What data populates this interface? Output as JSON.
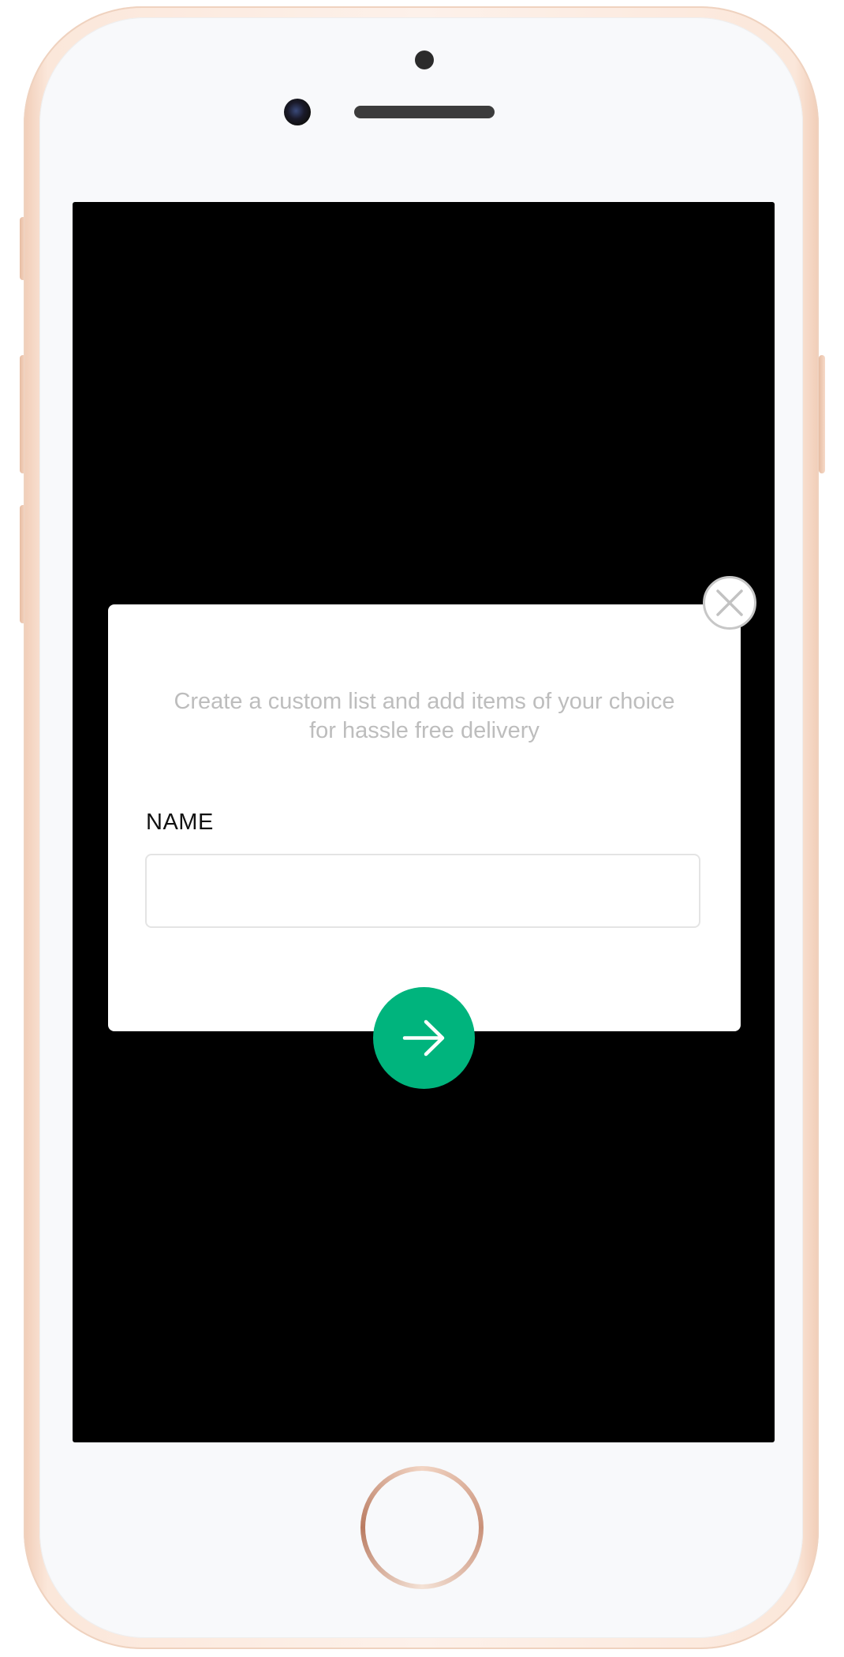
{
  "modal": {
    "description_line1": "Create a custom list and add items of your choice",
    "description_line2": "for hassle free delivery",
    "name_label": "NAME",
    "name_value": "",
    "name_placeholder": ""
  },
  "icons": {
    "close": "close-icon",
    "next": "arrow-right-icon"
  },
  "colors": {
    "accent": "#00b47d",
    "screen_background": "#000000",
    "modal_background": "#ffffff",
    "description_text": "#bdbdbd"
  }
}
